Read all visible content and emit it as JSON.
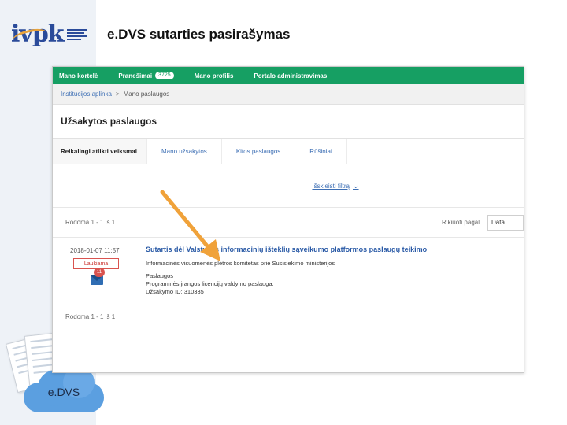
{
  "slide": {
    "title": "e.DVS sutarties pasirašymas",
    "logo_text": "ivpk",
    "cloud_label": "e.DVS"
  },
  "nav": {
    "items": [
      {
        "label": "Mano kortelė"
      },
      {
        "label": "Pranešimai",
        "badge": "3725"
      },
      {
        "label": "Mano profilis"
      },
      {
        "label": "Portalo administravimas"
      }
    ]
  },
  "breadcrumb": {
    "parent": "Institucijos aplinka",
    "separator": ">",
    "current": "Mano paslaugos"
  },
  "page": {
    "heading": "Užsakytos paslaugos"
  },
  "tabs": [
    {
      "label": "Reikalingi atlikti veiksmai",
      "active": true
    },
    {
      "label": "Mano užsakytos",
      "active": false
    },
    {
      "label": "Kitos paslaugos",
      "active": false
    },
    {
      "label": "Rūšiniai",
      "active": false
    }
  ],
  "filters": {
    "expand_label": "Išskleisti filtrą",
    "showing_top": "Rodoma 1 - 1 iš 1",
    "sort_label": "Rikiuoti pagal",
    "sort_value": "Data",
    "showing_bottom": "Rodoma 1 - 1 iš 1"
  },
  "item": {
    "date": "2018-01-07 11:57",
    "status": "Laukiama",
    "mail_count": "11",
    "title": "Sutartis dėl Valstybės informacinių išteklių sąveikumo platformos paslaugų teikimo",
    "organization": "Informacinės visuomenės plėtros komitetas prie Susisiekimo ministerijos",
    "category": "Paslaugos",
    "service": "Programinės įrangos licencijų valdymo paslauga;",
    "order_id": "Užsakymo ID: 310335"
  },
  "colors": {
    "nav_green": "#169f63",
    "link_blue": "#3c6eb4",
    "status_red": "#d9534f",
    "arrow_orange": "#f0a23a"
  }
}
